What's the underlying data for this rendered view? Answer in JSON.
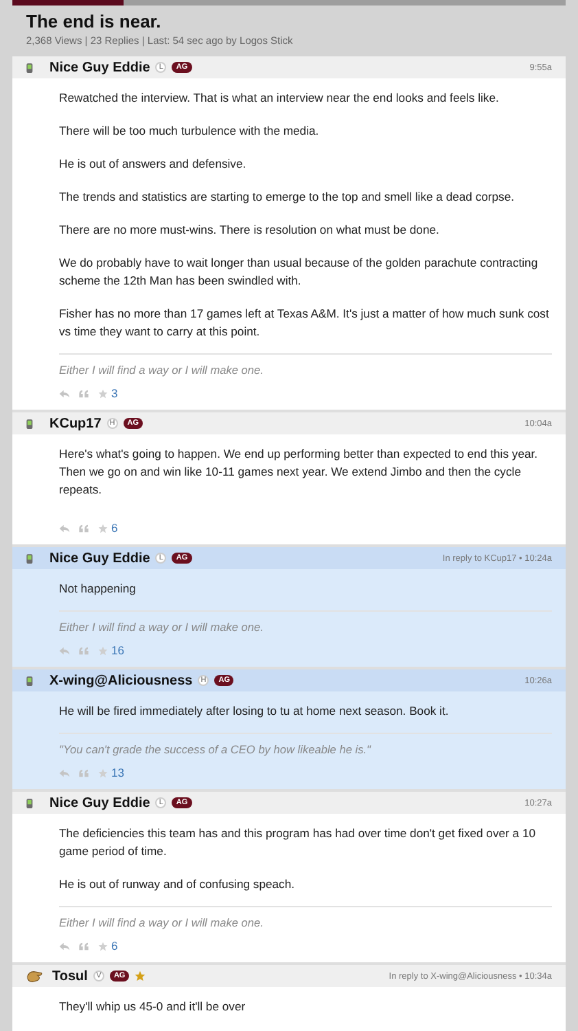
{
  "progress": {
    "level": 0.2
  },
  "thread": {
    "title": "The end is near.",
    "meta": "2,368 Views | 23 Replies | Last: 54 sec ago by Logos Stick"
  },
  "posts": [
    {
      "kind": "phone",
      "author": "Nice Guy Eddie",
      "level_badge": "L",
      "group_badge": "AG",
      "starred": false,
      "time": "9:55a",
      "highlighted": false,
      "paragraphs": [
        "Rewatched the interview. That is what an interview near the end looks and feels like.",
        "There will be too much turbulence with the media.",
        "He is out of answers and defensive.",
        "The trends and statistics are starting to emerge to the top and smell like a dead corpse.",
        "There are no more must-wins. There is resolution on what must be done.",
        "We do probably have to wait longer than usual because of the golden parachute contracting scheme the 12th Man has been swindled with.",
        "Fisher has no more than 17 games left at Texas A&M. It's just a matter of how much sunk cost vs time they want to carry at this point."
      ],
      "signature": "Either I will find a way or I will make one.",
      "rating": "3"
    },
    {
      "kind": "phone",
      "author": "KCup17",
      "level_badge": "H",
      "group_badge": "AG",
      "starred": false,
      "time": "10:04a",
      "highlighted": false,
      "paragraphs": [
        "Here's what's going to happen. We end up performing better than expected to end this year. Then we go on and win like 10-11 games next year. We extend Jimbo and then the cycle repeats."
      ],
      "rating": "6"
    },
    {
      "kind": "phone",
      "author": "Nice Guy Eddie",
      "level_badge": "L",
      "group_badge": "AG",
      "starred": false,
      "reply_to": "In reply to KCup17 • 10:24a",
      "highlighted": true,
      "paragraphs": [
        "Not happening"
      ],
      "signature": "Either I will find a way or I will make one.",
      "rating": "16"
    },
    {
      "kind": "phone",
      "author": "X-wing@Aliciousness",
      "level_badge": "H",
      "group_badge": "AG",
      "starred": false,
      "time": "10:26a",
      "highlighted": true,
      "paragraphs": [
        "He will be fired immediately after losing to tu at home next season. Book it."
      ],
      "signature": "\"You can't grade the success of a CEO by how likeable he is.\"",
      "rating": "13"
    },
    {
      "kind": "phone",
      "author": "Nice Guy Eddie",
      "level_badge": "L",
      "group_badge": "AG",
      "starred": false,
      "time": "10:27a",
      "highlighted": false,
      "paragraphs": [
        "The deficiencies this team has and this program has had over time don't get fixed over a 10 game period of time.",
        "He is out of runway and of confusing speach."
      ],
      "signature": "Either I will find a way or I will make one.",
      "rating": "6"
    },
    {
      "kind": "hand",
      "author": "Tosul",
      "level_badge": "V",
      "group_badge": "AG",
      "starred": true,
      "reply_to": "In reply to X-wing@Aliciousness • 10:34a",
      "highlighted": false,
      "paragraphs": [
        "They'll whip us 45-0 and it'll be over"
      ]
    }
  ]
}
